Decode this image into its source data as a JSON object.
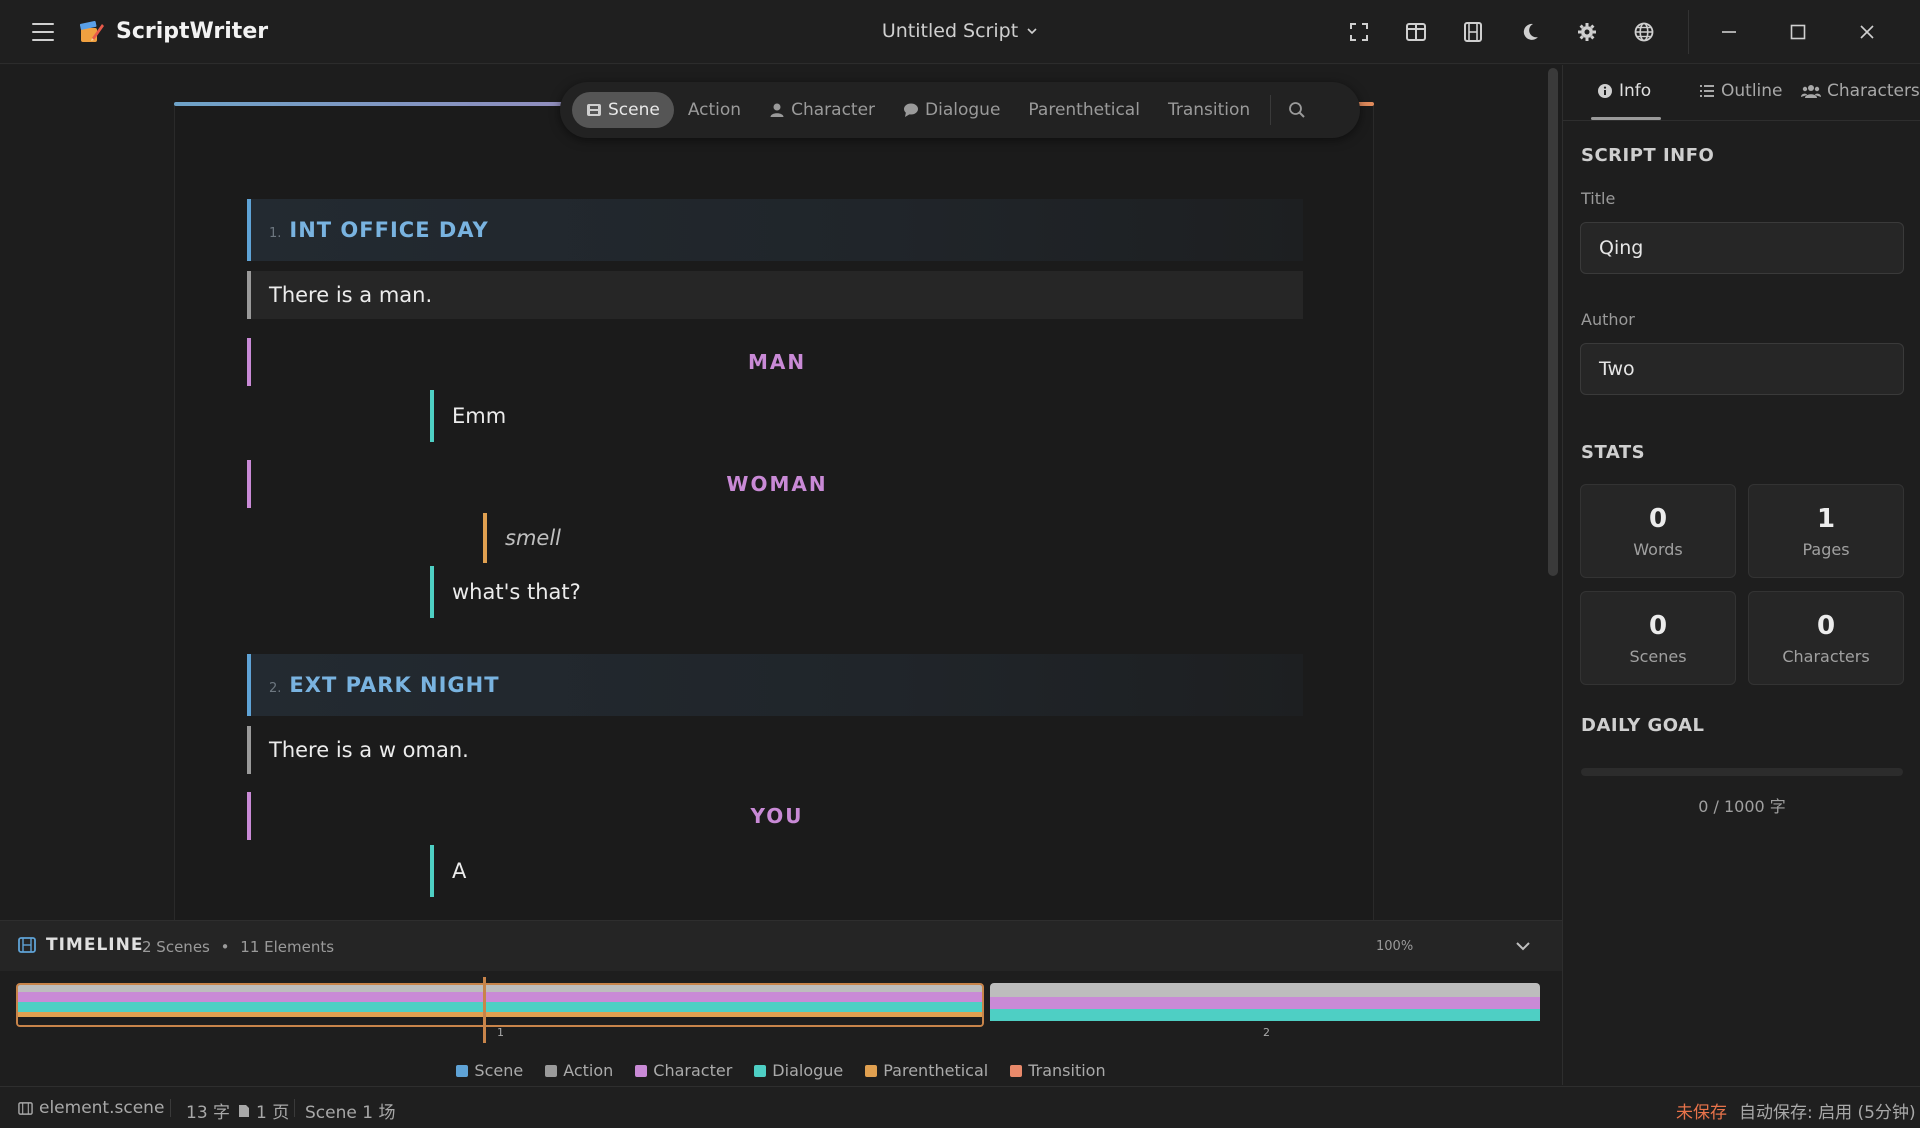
{
  "app": {
    "name": "ScriptWriter",
    "doc_title": "Untitled Script"
  },
  "toolbar": {
    "items": [
      {
        "label": "Scene",
        "active": true
      },
      {
        "label": "Action"
      },
      {
        "label": "Character"
      },
      {
        "label": "Dialogue"
      },
      {
        "label": "Parenthetical"
      },
      {
        "label": "Transition"
      }
    ]
  },
  "script": {
    "scene1": {
      "num": "1.",
      "heading": "INT OFFICE DAY"
    },
    "action1": "There is a man.",
    "char1": "MAN",
    "dial1": "Emm",
    "char2": "WOMAN",
    "paren1": "smell",
    "dial2": "what's that?",
    "scene2": {
      "num": "2.",
      "heading": "EXT PARK NIGHT"
    },
    "action2": "There is a w oman.",
    "char3": "YOU",
    "dial3": "A"
  },
  "right_panel": {
    "tabs": [
      "Info",
      "Outline",
      "Characters"
    ],
    "script_info_title": "SCRIPT INFO",
    "title_label": "Title",
    "title_value": "Qing",
    "author_label": "Author",
    "author_value": "Two",
    "stats_title": "STATS",
    "stats": [
      {
        "value": "0",
        "label": "Words"
      },
      {
        "value": "1",
        "label": "Pages"
      },
      {
        "value": "0",
        "label": "Scenes"
      },
      {
        "value": "0",
        "label": "Characters"
      }
    ],
    "daily_goal_title": "DAILY GOAL",
    "daily_goal_progress": 0,
    "daily_goal_text": "0 / 1000 字"
  },
  "timeline": {
    "title": "TIMELINE",
    "scenes_count": "2 Scenes",
    "elements_count": "11 Elements",
    "zoom": "100%",
    "scene_labels": [
      "1",
      "2"
    ],
    "legend": [
      "Scene",
      "Action",
      "Character",
      "Dialogue",
      "Parenthetical",
      "Transition"
    ]
  },
  "statusbar": {
    "element": "element.scene",
    "chars": "13 字",
    "pages": "1 页",
    "scene": "Scene 1 场",
    "unsaved": "未保存",
    "autosave": "自动保存: 启用 (5分钟)"
  },
  "colors": {
    "scene": "#5fa3d6",
    "action": "#9a9a9a",
    "character": "#c98ad6",
    "dialogue": "#4ecfc4",
    "parenthetical": "#e0a050",
    "transition": "#e8896a",
    "unsaved": "#e8734a"
  }
}
